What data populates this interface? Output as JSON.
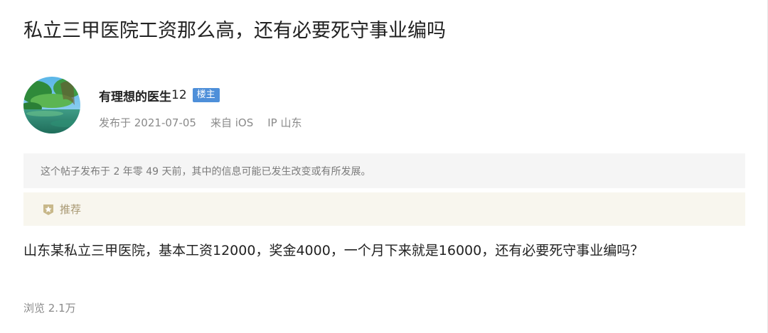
{
  "post": {
    "title": "私立三甲医院工资那么高，还有必要死守事业编吗",
    "content": "山东某私立三甲医院，基本工资12000，奖金4000，一个月下来就是16000，还有必要死守事业编吗？"
  },
  "author": {
    "name": "有理想的医生",
    "name_suffix": "12",
    "badge": "楼主",
    "avatar_icon": "landscape-avatar"
  },
  "meta": {
    "published": "发布于 2021-07-05",
    "source": "来自 iOS",
    "ip": "IP 山东"
  },
  "notice": {
    "text": "这个帖子发布于 2 年零 49 天前，其中的信息可能已发生改变或有所发展。"
  },
  "recommend": {
    "label": "推荐",
    "icon": "star-badge-icon"
  },
  "stats": {
    "views": "浏览 2.1万"
  },
  "colors": {
    "badge_bg": "#4e8fd9",
    "notice_bg": "#f5f5f5",
    "recommend_bg": "#f8f6ee",
    "recommend_text": "#a89872",
    "meta_text": "#8a8a8a"
  }
}
